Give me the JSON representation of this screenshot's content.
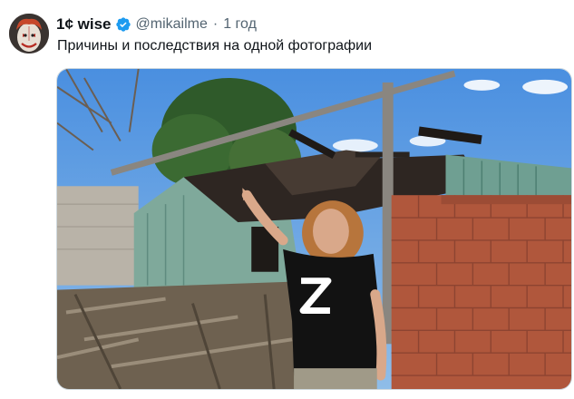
{
  "tweet": {
    "author_name": "1¢ wise",
    "handle": "@mikailme",
    "separator": "·",
    "time": "1 год",
    "text": "Причины и последствия на одной фотографии"
  },
  "icons": {
    "avatar": "clown-avatar",
    "verified": "verified-badge-icon"
  },
  "colors": {
    "verified_blue": "#1d9bf0",
    "secondary_text": "#536471"
  }
}
